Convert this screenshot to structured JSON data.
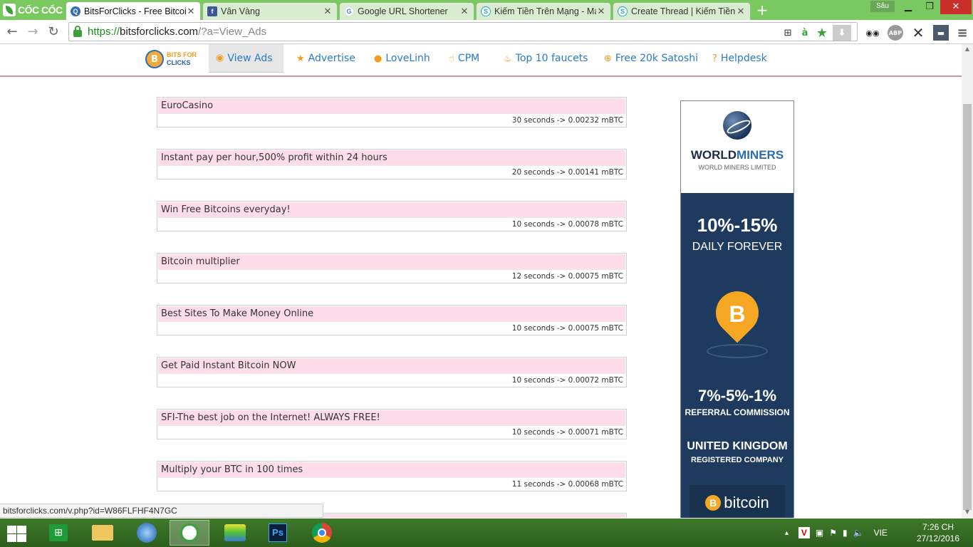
{
  "browser": {
    "brand": "CỐC CỐC",
    "profile_badge": "Sâu",
    "tabs": [
      {
        "title": "BitsForClicks - Free Bitcoin",
        "icon": "bitsforclicks-icon"
      },
      {
        "title": "Vân Vàng",
        "icon": "facebook-icon"
      },
      {
        "title": "Google URL Shortener",
        "icon": "google-icon"
      },
      {
        "title": "Kiếm Tiền Trên Mạng - Mạ",
        "icon": "kiemtien-icon"
      },
      {
        "title": "Create Thread | Kiếm Tiền",
        "icon": "kiemtien-icon"
      }
    ],
    "url": {
      "scheme": "https://",
      "host": "bitsforclicks.com",
      "path": "/?a=View_Ads"
    },
    "status_url": "bitsforclicks.com/v.php?id=W86FLFHF4N7GC"
  },
  "site": {
    "logo_top": "BITS FOR",
    "logo_bottom": "CLICKS",
    "nav": [
      {
        "label": "View Ads",
        "icon": "eye-icon"
      },
      {
        "label": "Advertise",
        "icon": "star-icon"
      },
      {
        "label": "LoveLinh",
        "icon": "user-icon"
      },
      {
        "label": "CPM",
        "icon": "thumbs-up-icon"
      },
      {
        "label": "Top 10 faucets",
        "icon": "fire-icon"
      },
      {
        "label": "Free 20k Satoshi",
        "icon": "plus-circle-icon"
      },
      {
        "label": "Helpdesk",
        "icon": "question-icon"
      }
    ]
  },
  "ads": [
    {
      "title": "EuroCasino",
      "info": "30 seconds -> 0.00232 mBTC"
    },
    {
      "title": "Instant pay per hour,500% profit within 24 hours",
      "info": "20 seconds -> 0.00141 mBTC"
    },
    {
      "title": "Win Free Bitcoins everyday!",
      "info": "10 seconds -> 0.00078 mBTC"
    },
    {
      "title": "Bitcoin multiplier",
      "info": "12 seconds -> 0.00075 mBTC"
    },
    {
      "title": "Best Sites To Make Money Online",
      "info": "10 seconds -> 0.00075 mBTC"
    },
    {
      "title": "Get Paid Instant Bitcoin NOW",
      "info": "10 seconds -> 0.00072 mBTC"
    },
    {
      "title": "SFI-The best job on the Internet! ALWAYS FREE!",
      "info": "10 seconds -> 0.00071 mBTC"
    },
    {
      "title": "Multiply your BTC in 100 times",
      "info": "11 seconds -> 0.00068 mBTC"
    }
  ],
  "banner": {
    "brand_world": "WORLD",
    "brand_miners": "MINERS",
    "brand_sub": "WORLD MINERS LIMITED",
    "headline1": "10%-15%",
    "sub1": "DAILY FOREVER",
    "bitcoin_symbol": "B",
    "headline2": "7%-5%-1%",
    "sub2": "REFERRAL COMMISSION",
    "headline3": "UNITED KINGDOM",
    "sub3": "REGISTERED COMPANY",
    "bitcoin_word": "bitcoin"
  },
  "taskbar": {
    "language": "VIE",
    "time": "7:26 CH",
    "date": "27/12/2016"
  },
  "colors": {
    "tabstrip": "#79c860",
    "link": "#2a7ac5",
    "ad_title_bg": "#ffdcea",
    "banner_bg": "#1e3a5f",
    "bitcoin_orange": "#f5a623"
  }
}
